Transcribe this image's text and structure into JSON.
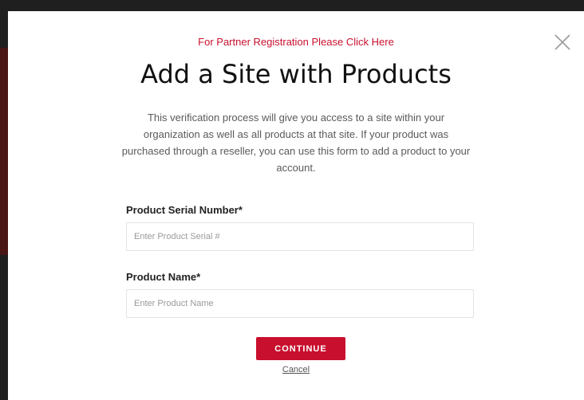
{
  "modal": {
    "partner_link": "For Partner Registration Please Click Here",
    "title": "Add a Site with Products",
    "description": "This verification process will give you access to a site within your organization as well as all products at that site. If your product was purchased through a reseller, you can use this form to add a product to your account.",
    "close_icon": "close-x-icon"
  },
  "form": {
    "serial": {
      "label": "Product Serial Number*",
      "placeholder": "Enter Product Serial #",
      "value": ""
    },
    "name": {
      "label": "Product Name*",
      "placeholder": "Enter Product Name",
      "value": ""
    },
    "continue_label": "CONTINUE",
    "cancel_label": "Cancel"
  },
  "colors": {
    "accent": "#c8102e",
    "backdrop": "#1f1f1f",
    "modal_background": "#ffffff"
  }
}
